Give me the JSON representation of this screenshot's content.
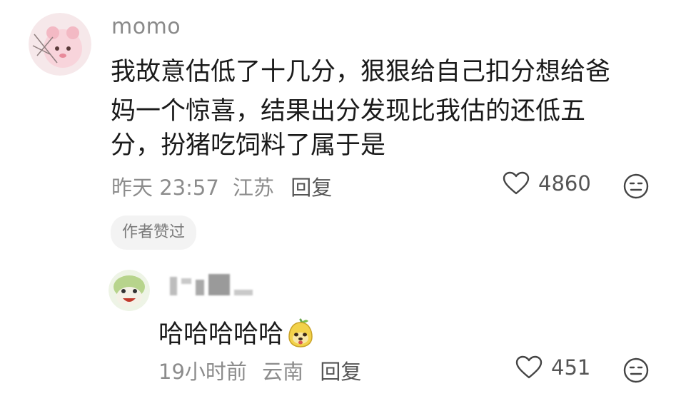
{
  "comment": {
    "username": "momo",
    "text_lines": [
      "我故意估低了十几分，狠狠给自己扣分想给爸",
      "妈一个惊喜，结果出分发现比我估的还低五",
      "分，扮猪吃饲料了属于是"
    ],
    "time": "昨天 23:57",
    "location": "江苏",
    "reply_label": "回复",
    "like_count": "4860",
    "author_badge": "作者赞过",
    "avatar_icon": "pink-bear-avatar",
    "like_icon": "heart-outline-icon",
    "dislike_icon": "meh-face-icon"
  },
  "reply": {
    "text": "哈哈哈哈哈",
    "emoji_icon": "doge-pear-emoji",
    "time": "19小时前",
    "location": "云南",
    "reply_label": "回复",
    "like_count": "451",
    "avatar_icon": "green-cartoon-avatar",
    "like_icon": "heart-outline-icon",
    "dislike_icon": "meh-face-icon"
  },
  "colors": {
    "username": "#8a8a8a",
    "text": "#1a1a1a",
    "meta": "#8c8c8c",
    "badge_bg": "#f3f3f3"
  }
}
